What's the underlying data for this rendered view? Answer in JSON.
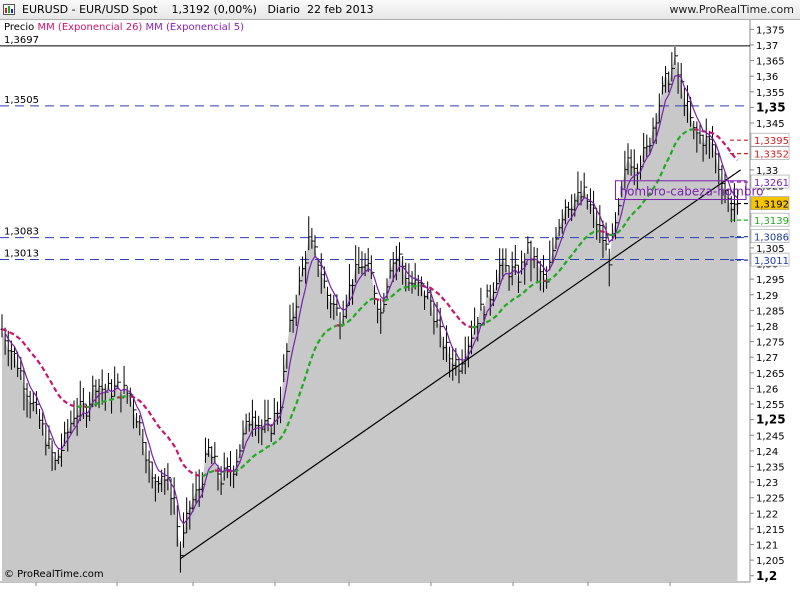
{
  "header": {
    "title": "EURUSD - EUR/USD Spot    1,3192 (0,00%)   Diario  22 feb 2013",
    "brand": "www.ProRealTime.com"
  },
  "legend": {
    "price": "Precio",
    "ma_slow": "MM (Exponencial 26)",
    "ma_fast": "MM (Exponencial 5)"
  },
  "footer": {
    "copyright": "© ProRealTime.com"
  },
  "annotation": {
    "pattern_label": "hombro-cabeza-hombro"
  },
  "colors": {
    "candle": "#000000",
    "ema26": "#c8156e",
    "ema5": "#7a1fb0",
    "trend_green": "#22aa22",
    "fill": "#c8c8c8",
    "badge_close": "#f5c400"
  },
  "chart_data": {
    "type": "line",
    "title": "EURUSD - EUR/USD Spot",
    "ylim": [
      1.198,
      1.378
    ],
    "y_ticks": [
      "1,375",
      "1,37",
      "1,365",
      "1,36",
      "1,355",
      "1,35",
      "1,345",
      "1,34",
      "1,335",
      "1,33",
      "1,325",
      "1,32",
      "1,315",
      "1,31",
      "1,305",
      "1,30",
      "1,295",
      "1,29",
      "1,285",
      "1,28",
      "1,275",
      "1,27",
      "1,265",
      "1,26",
      "1,255",
      "1,25",
      "1,245",
      "1,24",
      "1,235",
      "1,23",
      "1,225",
      "1,22",
      "1,215",
      "1,21",
      "1,205",
      "1,2"
    ],
    "bold_ticks": [
      "1,35",
      "1,3",
      "1,25",
      "1,2"
    ],
    "x_tick_labels": [
      "jun",
      "jul",
      "ago",
      "sep",
      "oct",
      "nov",
      "dic",
      "2013",
      "feb"
    ],
    "price_keypoints": [
      [
        0,
        1.279
      ],
      [
        5,
        1.268
      ],
      [
        9,
        1.257
      ],
      [
        13,
        1.247
      ],
      [
        17,
        1.236
      ],
      [
        20,
        1.243
      ],
      [
        23,
        1.252
      ],
      [
        27,
        1.254
      ],
      [
        30,
        1.262
      ],
      [
        33,
        1.259
      ],
      [
        37,
        1.26
      ],
      [
        41,
        1.258
      ],
      [
        45,
        1.245
      ],
      [
        48,
        1.23
      ],
      [
        51,
        1.233
      ],
      [
        55,
        1.225
      ],
      [
        57,
        1.207
      ],
      [
        60,
        1.222
      ],
      [
        63,
        1.228
      ],
      [
        66,
        1.24
      ],
      [
        70,
        1.231
      ],
      [
        74,
        1.235
      ],
      [
        77,
        1.244
      ],
      [
        80,
        1.253
      ],
      [
        83,
        1.247
      ],
      [
        86,
        1.248
      ],
      [
        89,
        1.256
      ],
      [
        92,
        1.279
      ],
      [
        95,
        1.293
      ],
      [
        98,
        1.307
      ],
      [
        101,
        1.301
      ],
      [
        104,
        1.29
      ],
      [
        108,
        1.283
      ],
      [
        112,
        1.295
      ],
      [
        115,
        1.3
      ],
      [
        118,
        1.296
      ],
      [
        121,
        1.284
      ],
      [
        124,
        1.3
      ],
      [
        127,
        1.302
      ],
      [
        130,
        1.294
      ],
      [
        134,
        1.292
      ],
      [
        137,
        1.288
      ],
      [
        140,
        1.277
      ],
      [
        143,
        1.27
      ],
      [
        146,
        1.268
      ],
      [
        149,
        1.275
      ],
      [
        152,
        1.283
      ],
      [
        156,
        1.29
      ],
      [
        159,
        1.299
      ],
      [
        162,
        1.298
      ],
      [
        165,
        1.296
      ],
      [
        168,
        1.304
      ],
      [
        171,
        1.299
      ],
      [
        174,
        1.293
      ],
      [
        177,
        1.31
      ],
      [
        180,
        1.319
      ],
      [
        183,
        1.32
      ],
      [
        186,
        1.322
      ],
      [
        189,
        1.316
      ],
      [
        192,
        1.308
      ],
      [
        194,
        1.302
      ],
      [
        197,
        1.316
      ],
      [
        200,
        1.334
      ],
      [
        203,
        1.332
      ],
      [
        206,
        1.336
      ],
      [
        209,
        1.348
      ],
      [
        212,
        1.358
      ],
      [
        215,
        1.364
      ],
      [
        218,
        1.353
      ],
      [
        221,
        1.342
      ],
      [
        224,
        1.34
      ],
      [
        227,
        1.338
      ],
      [
        230,
        1.328
      ],
      [
        232,
        1.32
      ],
      [
        233,
        1.3192
      ]
    ],
    "last_close": 1.3192,
    "horizontal_levels": [
      {
        "value": 1.3697,
        "label": "1,3697",
        "style": "solid"
      },
      {
        "value": 1.3505,
        "label": "1,3505",
        "style": "dashed"
      },
      {
        "value": 1.3083,
        "label": "1,3083",
        "style": "dashed"
      },
      {
        "value": 1.3013,
        "label": "1,3013",
        "style": "dashed"
      }
    ],
    "right_badges": [
      {
        "value": 1.3395,
        "label": "1,3395",
        "color": "#cc2222"
      },
      {
        "value": 1.3352,
        "label": "1,3352",
        "color": "#cc2222"
      },
      {
        "value": 1.3261,
        "label": "1,3261",
        "color": "#7a1fb0"
      },
      {
        "value": 1.3192,
        "label": "1,3192",
        "color": "#000000"
      },
      {
        "value": 1.3139,
        "label": "1,3139",
        "color": "#22aa22"
      },
      {
        "value": 1.3086,
        "label": "1,3086",
        "color": "#1a3aa0"
      },
      {
        "value": 1.3011,
        "label": "1,3011",
        "color": "#1a3aa0"
      }
    ],
    "trendline": [
      [
        57,
        1.2055
      ],
      [
        236,
        1.33
      ]
    ]
  }
}
